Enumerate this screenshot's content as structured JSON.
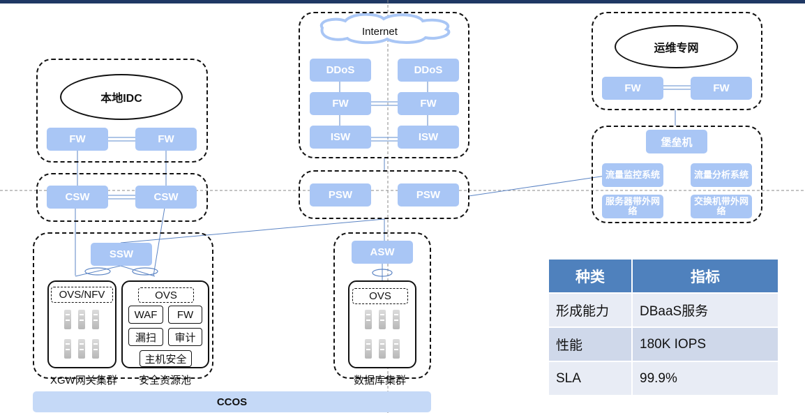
{
  "internet": {
    "label": "Internet"
  },
  "local_idc": {
    "title": "本地IDC",
    "fw_left": "FW",
    "fw_right": "FW",
    "csw_left": "CSW",
    "csw_right": "CSW"
  },
  "internet_zone": {
    "ddos_left": "DDoS",
    "ddos_right": "DDoS",
    "fw_left": "FW",
    "fw_right": "FW",
    "isw_left": "ISW",
    "isw_right": "ISW",
    "psw_left": "PSW",
    "psw_right": "PSW"
  },
  "ops": {
    "title": "运维专网",
    "fw_left": "FW",
    "fw_right": "FW",
    "bastion": "堡垒机",
    "traffic_monitor": "流量监控系统",
    "traffic_analysis": "流量分析系统",
    "server_oob": "服务器带外网络",
    "switch_oob": "交换机带外网络"
  },
  "cluster": {
    "ssw": "SSW",
    "ovs_nfv": "OVS/NFV",
    "ovs_sec": "OVS",
    "waf": "WAF",
    "fw": "FW",
    "scan": "漏扫",
    "audit": "审计",
    "host_sec": "主机安全",
    "xgw_caption": "XGW网关集群",
    "sec_caption": "安全资源池"
  },
  "db": {
    "asw": "ASW",
    "ovs": "OVS",
    "caption": "数据库集群"
  },
  "ccos": "CCOS",
  "table": {
    "headers": [
      "种类",
      "指标"
    ],
    "rows": [
      [
        "形成能力",
        "DBaaS服务"
      ],
      [
        "性能",
        "180K IOPS"
      ],
      [
        "SLA",
        "99.9%"
      ]
    ]
  }
}
